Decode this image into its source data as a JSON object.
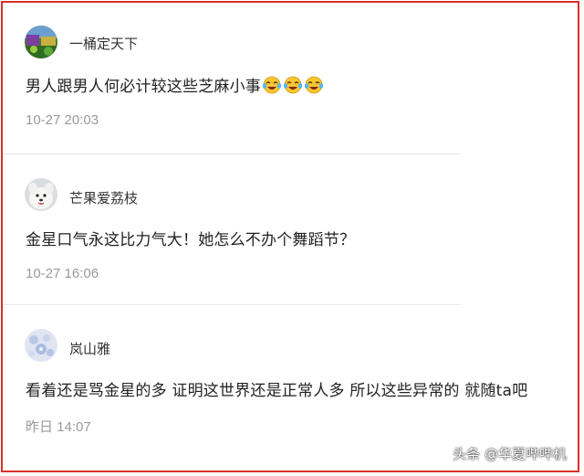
{
  "comments": [
    {
      "username": "一桶定天下",
      "text": "男人跟男人何必计较这些芝麻小事",
      "emojis": [
        "laugh-cry-emoji",
        "laugh-cry-emoji",
        "laugh-cry-emoji"
      ],
      "time": "10-27 20:03",
      "avatar": "garden-avatar"
    },
    {
      "username": "芒果爱荔枝",
      "text": "金星口气永这比力气大！她怎么不办个舞蹈节？",
      "time": "10-27 16:06",
      "avatar": "white-dog-avatar"
    },
    {
      "username": "岚山雅",
      "text": "看着还是骂金星的多 证明这世界还是正常人多 所以这些异常的 就随ta吧",
      "time": "昨日 14:07",
      "avatar": "floral-avatar"
    }
  ],
  "watermark": "头条 @华夏哔哔机",
  "colors": {
    "border": "#d9302a",
    "time_text": "#9a9a9a",
    "body_text": "#222222"
  }
}
